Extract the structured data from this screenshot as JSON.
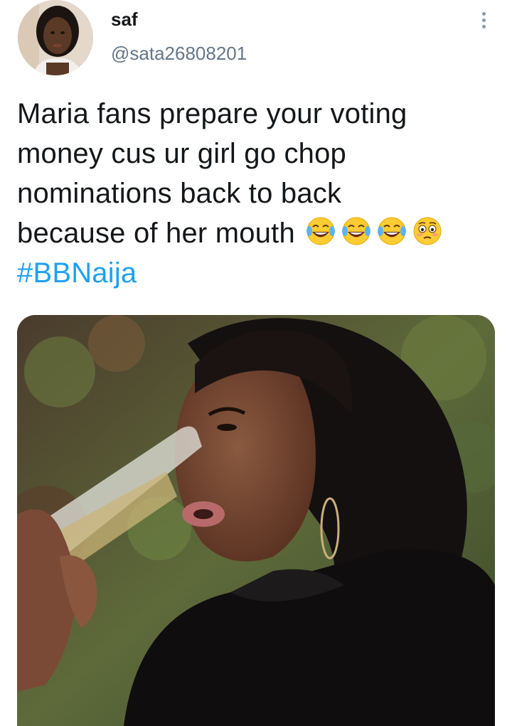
{
  "author": {
    "display_name": "saf",
    "handle": "@sata26808201",
    "avatar_icon": "profile-photo"
  },
  "menu": {
    "icon": "more-vertical-icon"
  },
  "tweet": {
    "text_lines": [
      "Maria fans prepare your voting",
      "money cus ur girl go chop",
      "nominations back to back",
      "because of her mouth"
    ],
    "emojis": [
      "tears-of-joy-emoji",
      "tears-of-joy-emoji",
      "tears-of-joy-emoji",
      "flushed-face-emoji"
    ],
    "hashtag": "#BBNaija"
  },
  "media": {
    "type": "photo",
    "icon": "photo-woman-drinking"
  },
  "colors": {
    "text": "#14171a",
    "secondary": "#657786",
    "link": "#1da1f2",
    "menu_dots": "#8899a6"
  }
}
